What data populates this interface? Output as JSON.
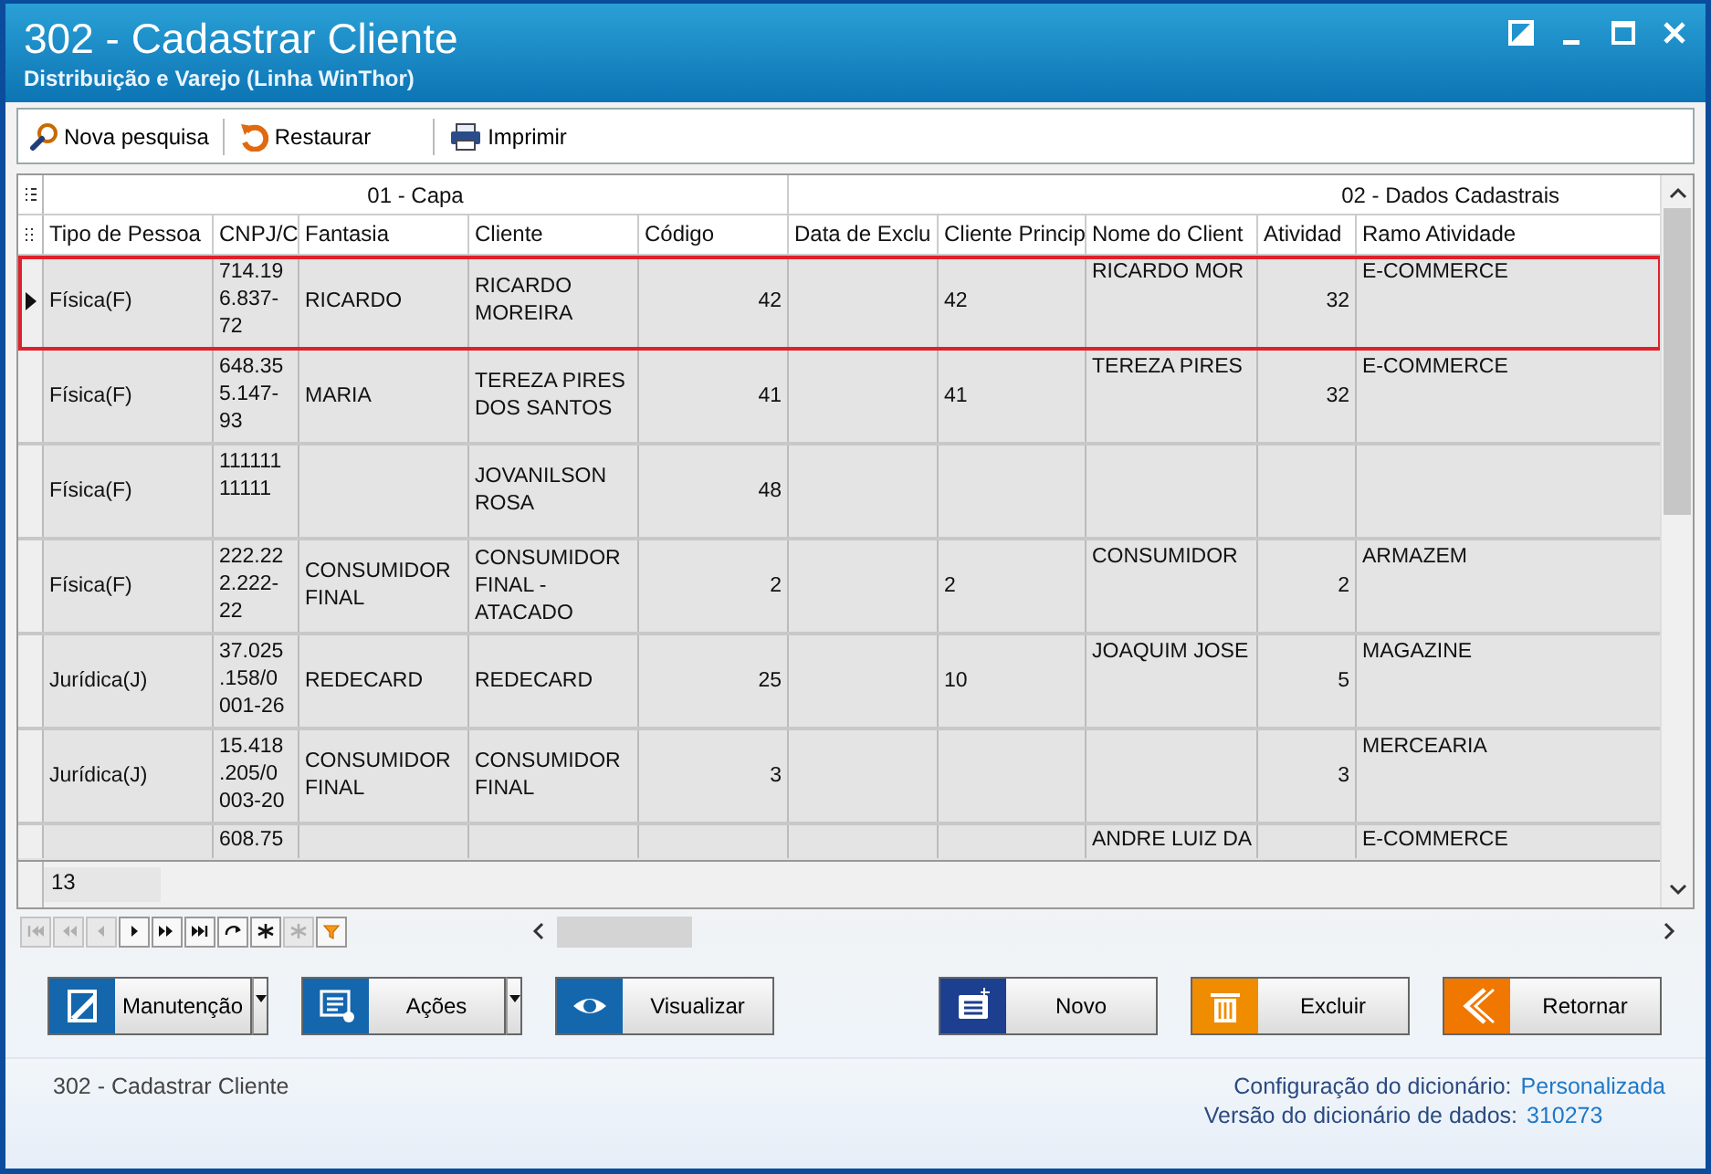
{
  "window": {
    "title": "302 - Cadastrar Cliente",
    "subtitle": "Distribuição e Varejo (Linha WinThor)"
  },
  "toolbar": [
    {
      "kind": "search",
      "label": "Nova pesquisa"
    },
    {
      "kind": "restore",
      "label": "Restaurar"
    },
    {
      "kind": "print",
      "label": "Imprimir"
    }
  ],
  "grid": {
    "column_groups": [
      "01 - Capa",
      "02 - Dados Cadastrais"
    ],
    "columns": [
      "Tipo de Pessoa",
      "CNPJ/C",
      "Fantasia",
      "Cliente",
      "Código",
      "Data de Exclu",
      "Cliente Princip",
      "Nome do Client",
      "Atividad",
      "Ramo Atividade"
    ],
    "rows": [
      {
        "selected": true,
        "cells": [
          "Física(F)",
          "714.196.837-72",
          "RICARDO",
          "RICARDO MOREIRA",
          "42",
          null,
          "42",
          "RICARDO MOR",
          "32",
          "E-COMMERCE"
        ]
      },
      {
        "selected": false,
        "cells": [
          "Física(F)",
          "648.355.147-93",
          "MARIA",
          "TEREZA PIRES DOS SANTOS",
          "41",
          null,
          "41",
          "TEREZA PIRES",
          "32",
          "E-COMMERCE"
        ]
      },
      {
        "selected": false,
        "cells": [
          "Física(F)",
          "11111111111",
          null,
          "JOVANILSON ROSA",
          "48",
          null,
          null,
          null,
          null,
          null
        ]
      },
      {
        "selected": false,
        "cells": [
          "Física(F)",
          "222.222.222-22",
          "CONSUMIDOR FINAL",
          "CONSUMIDOR FINAL - ATACADO",
          "2",
          null,
          "2",
          "CONSUMIDOR",
          "2",
          "ARMAZEM"
        ]
      },
      {
        "selected": false,
        "cells": [
          "Jurídica(J)",
          "37.025.158/0001-26",
          "REDECARD",
          "REDECARD",
          "25",
          null,
          "10",
          "JOAQUIM JOSE",
          "5",
          "MAGAZINE"
        ]
      },
      {
        "selected": false,
        "cells": [
          "Jurídica(J)",
          "15.418.205/0003-20",
          "CONSUMIDOR FINAL",
          "CONSUMIDOR FINAL",
          "3",
          null,
          null,
          null,
          "3",
          "MERCEARIA"
        ]
      },
      {
        "selected": false,
        "cells": [
          null,
          "608.75",
          null,
          null,
          null,
          null,
          null,
          "ANDRE LUIZ DA",
          null,
          "E-COMMERCE"
        ]
      }
    ],
    "record_count": "13"
  },
  "navigator": [
    {
      "kind": "first",
      "disabled": true
    },
    {
      "kind": "prior-page",
      "disabled": true
    },
    {
      "kind": "prior",
      "disabled": true
    },
    {
      "kind": "next",
      "disabled": false
    },
    {
      "kind": "next-page",
      "disabled": false
    },
    {
      "kind": "last",
      "disabled": false
    },
    {
      "kind": "refresh",
      "disabled": false
    },
    {
      "kind": "insert",
      "disabled": false
    },
    {
      "kind": "insert",
      "disabled": true
    },
    {
      "kind": "filter",
      "disabled": false
    }
  ],
  "buttons": [
    {
      "kind": "maintenance",
      "label": "Manutenção",
      "color": "#1466ad",
      "dropdown": true
    },
    {
      "kind": "actions",
      "label": "Ações",
      "color": "#1466ad",
      "dropdown": true
    },
    {
      "kind": "view",
      "label": "Visualizar",
      "color": "#1466ad",
      "dropdown": false
    },
    {
      "kind": "new",
      "label": "Novo",
      "color": "#1c3f8f",
      "dropdown": false
    },
    {
      "kind": "delete",
      "label": "Excluir",
      "color": "#f08c00",
      "dropdown": false
    },
    {
      "kind": "back",
      "label": "Retornar",
      "color": "#f07800",
      "dropdown": false
    }
  ],
  "status_bar": {
    "screen": "302 - Cadastrar Cliente",
    "dictionary_config_label": "Configuração do dicionário:",
    "dictionary_config": "Personalizada",
    "dictionary_version_label": "Versão do dicionário de dados:",
    "dictionary_version": "310273"
  }
}
